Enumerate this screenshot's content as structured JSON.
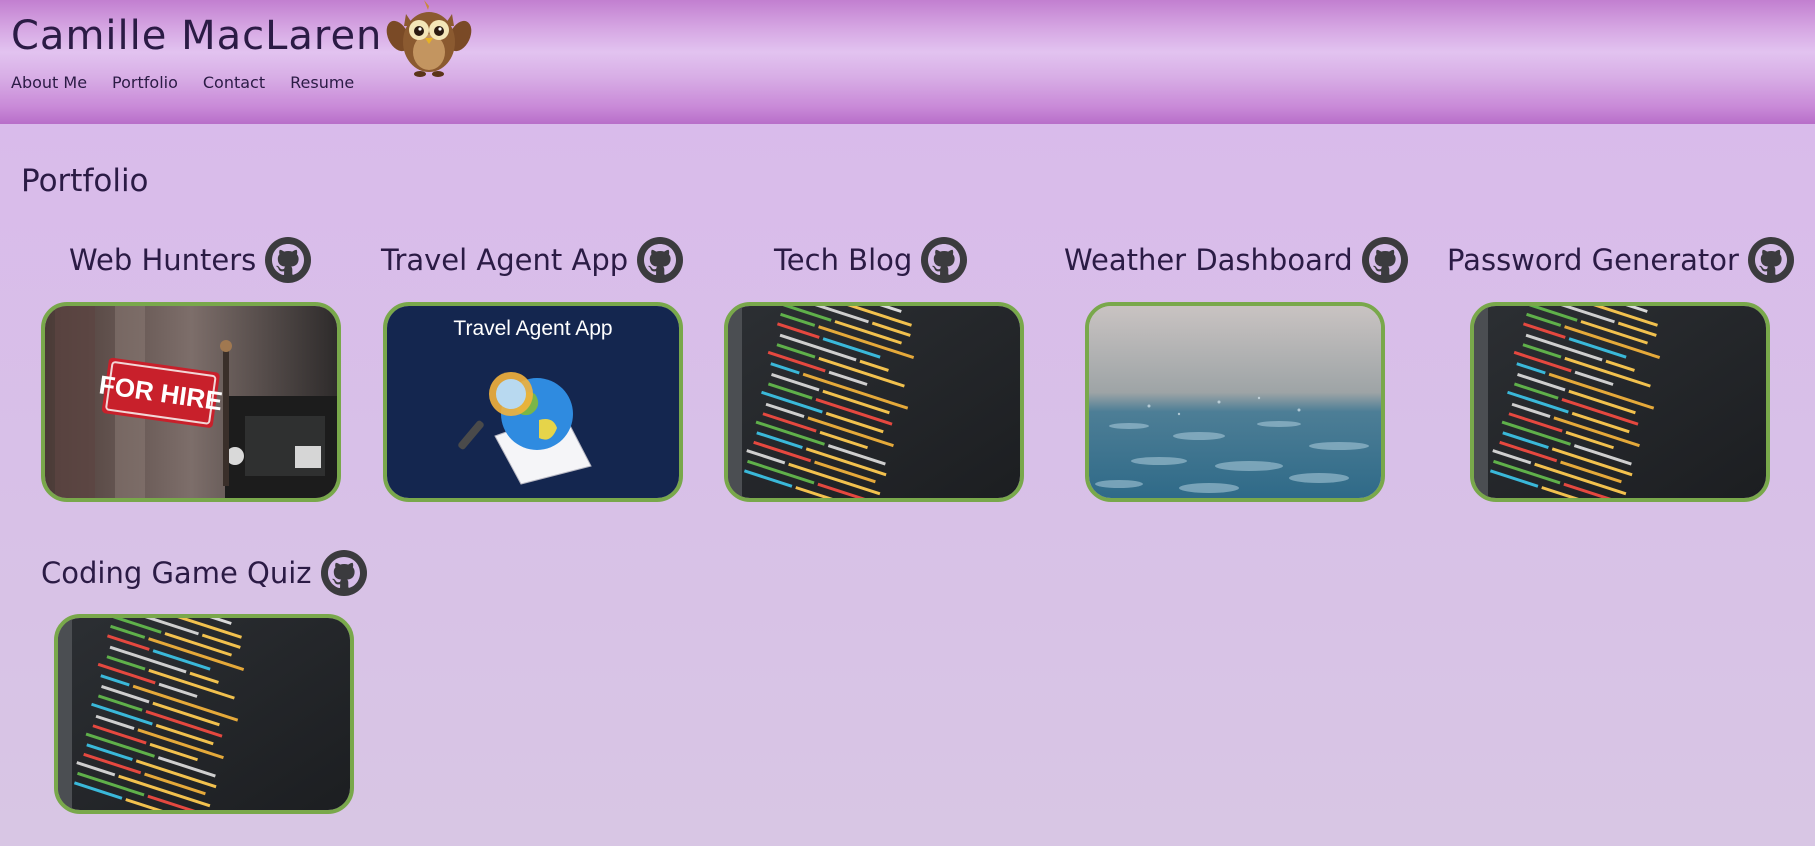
{
  "site": {
    "title": "Camille MacLaren"
  },
  "nav": [
    {
      "label": "About Me"
    },
    {
      "label": "Portfolio"
    },
    {
      "label": "Contact"
    },
    {
      "label": "Resume"
    }
  ],
  "portfolio": {
    "heading": "Portfolio",
    "projects": [
      {
        "name": "Web Hunters",
        "image_text": "FOR HIRE",
        "icon": "github-icon"
      },
      {
        "name": "Travel Agent App",
        "image_text": "Travel Agent App",
        "icon": "github-icon"
      },
      {
        "name": "Tech Blog",
        "icon": "github-icon"
      },
      {
        "name": "Weather Dashboard",
        "icon": "github-icon"
      },
      {
        "name": "Password Generator",
        "icon": "github-icon"
      },
      {
        "name": "Coding Game Quiz",
        "icon": "github-icon"
      }
    ]
  },
  "colors": {
    "thumbnail_border": "#79a84b",
    "accent_text": "#2b1b45"
  }
}
